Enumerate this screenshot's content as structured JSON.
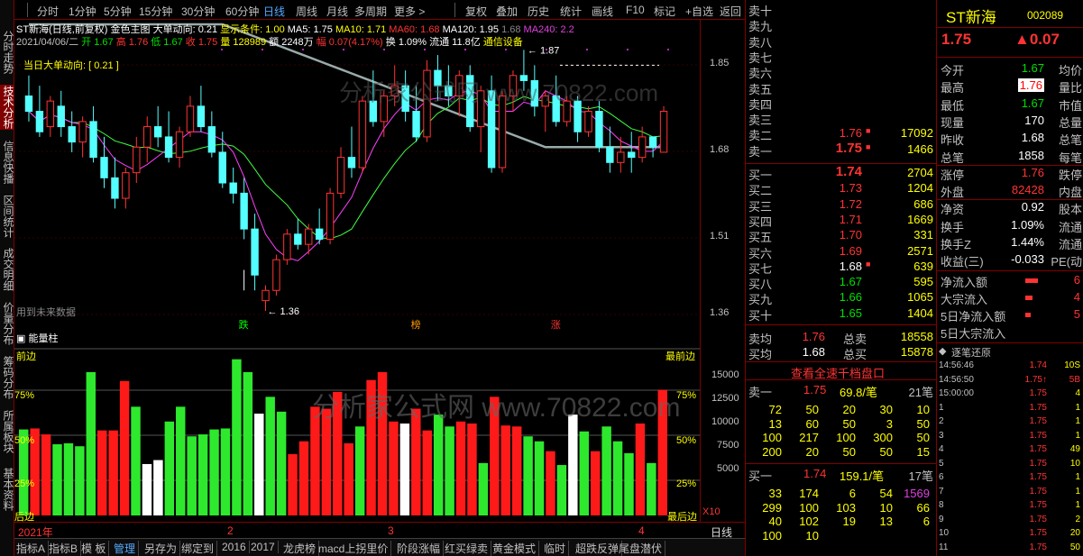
{
  "left_nav": [
    "分时走势",
    "技术分析",
    "信息快播",
    "区间统计",
    "成交明细",
    "价量分布",
    "筹码分布",
    "所属板块",
    "基本资料"
  ],
  "toolbar": {
    "items": [
      "分时",
      "1分钟",
      "5分钟",
      "15分钟",
      "30分钟",
      "60分钟",
      "日线",
      "周线",
      "月线",
      "多周期",
      "更多 >",
      "复权",
      "叠加",
      "历史",
      "统计",
      "画线",
      "F10",
      "标记",
      "+自选",
      "返回"
    ],
    "active": "日线"
  },
  "chart_info": {
    "title": "ST新海(日线,前复权)",
    "template": "金色主图",
    "dadong": "大单动向: 0.21",
    "show_cond": "显示条件: 1.00",
    "ma5": "MA5: 1.75",
    "ma10": "MA10: 1.71",
    "ma60": "MA60: 1.68",
    "ma120": "MA120: 1.95",
    "ma_extra": "1.68",
    "ma240": "MA240: 2.2",
    "date_line": "2021/04/06/二",
    "open": "开 1.67",
    "high": "高 1.76",
    "low": "低 1.67",
    "close": "收 1.75",
    "vol": "量 128989",
    "amt": "额 2248万",
    "amp": "幅 0.07(4.17%)",
    "turn": "换 1.09%",
    "float": "流通 11.8亿",
    "sector": "通信设备"
  },
  "chart_labels": {
    "dadong_tag": "当日大单动向: [ 0.21 ]",
    "future": "用到未来数据",
    "hi_mark": "1.87",
    "lo_mark": "1.36",
    "marker_die": "跌",
    "marker_bang": "榜",
    "marker_zhang": "涨",
    "watermark": "分析家公式网 www.70822.com"
  },
  "y_axis": [
    "1.85",
    "1.68",
    "1.51",
    "1.36"
  ],
  "vol_panel": {
    "title": "能量柱",
    "left_top": "前边",
    "right_top": "最前边",
    "right_bottom": "最后边",
    "left_bottom": "后边",
    "p75": "75%",
    "p50": "50%",
    "p25": "25%",
    "x10": "X10",
    "y": [
      "15000",
      "12500",
      "10000",
      "7500",
      "5000"
    ]
  },
  "date_axis": {
    "year": "2021年",
    "m2": "2",
    "m3": "3",
    "m4": "4",
    "period": "日线"
  },
  "bottom_tabs": [
    "指标A",
    "指标B",
    "模 板",
    "管理",
    "另存为",
    "绑定到",
    "2016",
    "2017",
    "龙虎榜",
    "macd上拐里价",
    "阶段涨幅",
    "红买绿卖",
    "黄金模式",
    "临时",
    "超跌反弹",
    "尾盘潜伏"
  ],
  "bottom_active": "管理",
  "chart_data": {
    "type": "candlestick",
    "title": "ST新海(日线,前复权)",
    "ylim": [
      1.33,
      1.92
    ],
    "ohlc": [
      [
        1.78,
        1.82,
        1.73,
        1.75
      ],
      [
        1.75,
        1.8,
        1.7,
        1.71
      ],
      [
        1.72,
        1.78,
        1.7,
        1.77
      ],
      [
        1.76,
        1.79,
        1.7,
        1.72
      ],
      [
        1.72,
        1.75,
        1.67,
        1.69
      ],
      [
        1.69,
        1.74,
        1.66,
        1.73
      ],
      [
        1.73,
        1.76,
        1.65,
        1.66
      ],
      [
        1.66,
        1.7,
        1.6,
        1.62
      ],
      [
        1.62,
        1.66,
        1.56,
        1.58
      ],
      [
        1.58,
        1.64,
        1.56,
        1.63
      ],
      [
        1.63,
        1.7,
        1.61,
        1.68
      ],
      [
        1.68,
        1.74,
        1.65,
        1.72
      ],
      [
        1.72,
        1.76,
        1.68,
        1.7
      ],
      [
        1.7,
        1.75,
        1.65,
        1.66
      ],
      [
        1.66,
        1.72,
        1.64,
        1.71
      ],
      [
        1.71,
        1.78,
        1.7,
        1.76
      ],
      [
        1.76,
        1.8,
        1.71,
        1.72
      ],
      [
        1.72,
        1.75,
        1.66,
        1.67
      ],
      [
        1.67,
        1.71,
        1.6,
        1.61
      ],
      [
        1.61,
        1.64,
        1.57,
        1.59
      ],
      [
        1.59,
        1.62,
        1.5,
        1.52
      ],
      [
        1.52,
        1.55,
        1.4,
        1.43
      ],
      [
        1.38,
        1.41,
        1.36,
        1.4
      ],
      [
        1.4,
        1.47,
        1.39,
        1.46
      ],
      [
        1.46,
        1.52,
        1.45,
        1.51
      ],
      [
        1.51,
        1.54,
        1.48,
        1.49
      ],
      [
        1.49,
        1.53,
        1.47,
        1.52
      ],
      [
        1.52,
        1.56,
        1.49,
        1.5
      ],
      [
        1.5,
        1.6,
        1.49,
        1.59
      ],
      [
        1.59,
        1.68,
        1.58,
        1.66
      ],
      [
        1.66,
        1.72,
        1.62,
        1.64
      ],
      [
        1.64,
        1.78,
        1.63,
        1.77
      ],
      [
        1.77,
        1.83,
        1.72,
        1.73
      ],
      [
        1.73,
        1.79,
        1.7,
        1.78
      ],
      [
        1.78,
        1.84,
        1.76,
        1.8
      ],
      [
        1.8,
        1.83,
        1.73,
        1.75
      ],
      [
        1.75,
        1.8,
        1.69,
        1.7
      ],
      [
        1.7,
        1.85,
        1.69,
        1.83
      ],
      [
        1.83,
        1.86,
        1.77,
        1.8
      ],
      [
        1.8,
        1.84,
        1.76,
        1.78
      ],
      [
        1.78,
        1.83,
        1.74,
        1.82
      ],
      [
        1.82,
        1.84,
        1.71,
        1.72
      ],
      [
        1.72,
        1.8,
        1.67,
        1.79
      ],
      [
        1.79,
        1.82,
        1.63,
        1.64
      ],
      [
        1.64,
        1.79,
        1.63,
        1.78
      ],
      [
        1.78,
        1.83,
        1.75,
        1.82
      ],
      [
        1.82,
        1.87,
        1.79,
        1.81
      ],
      [
        1.81,
        1.84,
        1.74,
        1.76
      ],
      [
        1.76,
        1.79,
        1.71,
        1.78
      ],
      [
        1.78,
        1.82,
        1.72,
        1.73
      ],
      [
        1.73,
        1.78,
        1.72,
        1.77
      ],
      [
        1.77,
        1.78,
        1.69,
        1.71
      ],
      [
        1.71,
        1.76,
        1.7,
        1.75
      ],
      [
        1.75,
        1.77,
        1.67,
        1.68
      ],
      [
        1.68,
        1.72,
        1.63,
        1.65
      ],
      [
        1.65,
        1.7,
        1.63,
        1.67
      ],
      [
        1.67,
        1.71,
        1.63,
        1.66
      ],
      [
        1.66,
        1.72,
        1.65,
        1.7
      ],
      [
        1.7,
        1.7,
        1.66,
        1.68
      ],
      [
        1.67,
        1.76,
        1.67,
        1.75
      ]
    ],
    "ma_series": [
      {
        "name": "MA5",
        "color": "#ff40ff"
      },
      {
        "name": "MA10",
        "color": "#40ff40"
      },
      {
        "name": "MA120",
        "color": "#9aa"
      }
    ],
    "volume": [
      {
        "v": 8700,
        "c": "g"
      },
      {
        "v": 8800,
        "c": "r"
      },
      {
        "v": 8200,
        "c": "r"
      },
      {
        "v": 7200,
        "c": "g"
      },
      {
        "v": 7300,
        "c": "g"
      },
      {
        "v": 7000,
        "c": "g"
      },
      {
        "v": 14500,
        "c": "g"
      },
      {
        "v": 8600,
        "c": "r"
      },
      {
        "v": 8600,
        "c": "r"
      },
      {
        "v": 13600,
        "c": "r"
      },
      {
        "v": 11000,
        "c": "g"
      },
      {
        "v": 5200,
        "c": "w"
      },
      {
        "v": 5600,
        "c": "w"
      },
      {
        "v": 9500,
        "c": "g"
      },
      {
        "v": 11000,
        "c": "g"
      },
      {
        "v": 8000,
        "c": "g"
      },
      {
        "v": 8200,
        "c": "g"
      },
      {
        "v": 8700,
        "c": "g"
      },
      {
        "v": 8800,
        "c": "g"
      },
      {
        "v": 15800,
        "c": "g"
      },
      {
        "v": 14500,
        "c": "g"
      },
      {
        "v": 10300,
        "c": "w"
      },
      {
        "v": 12000,
        "c": "g"
      },
      {
        "v": 10500,
        "c": "g"
      },
      {
        "v": 6200,
        "c": "r"
      },
      {
        "v": 7500,
        "c": "r"
      },
      {
        "v": 11000,
        "c": "r"
      },
      {
        "v": 10800,
        "c": "r"
      },
      {
        "v": 12500,
        "c": "r"
      },
      {
        "v": 7300,
        "c": "r"
      },
      {
        "v": 9000,
        "c": "g"
      },
      {
        "v": 13700,
        "c": "r"
      },
      {
        "v": 14500,
        "c": "r"
      },
      {
        "v": 9500,
        "c": "r"
      },
      {
        "v": 9300,
        "c": "w"
      },
      {
        "v": 10800,
        "c": "r"
      },
      {
        "v": 8600,
        "c": "r"
      },
      {
        "v": 10200,
        "c": "g"
      },
      {
        "v": 9000,
        "c": "g"
      },
      {
        "v": 9500,
        "c": "r"
      },
      {
        "v": 9300,
        "c": "r"
      },
      {
        "v": 5300,
        "c": "g"
      },
      {
        "v": 12000,
        "c": "r"
      },
      {
        "v": 9100,
        "c": "r"
      },
      {
        "v": 9000,
        "c": "r"
      },
      {
        "v": 8000,
        "c": "g"
      },
      {
        "v": 7500,
        "c": "g"
      },
      {
        "v": 6500,
        "c": "r"
      },
      {
        "v": 5100,
        "c": "g"
      },
      {
        "v": 10200,
        "c": "w"
      },
      {
        "v": 8500,
        "c": "g"
      },
      {
        "v": 6500,
        "c": "r"
      },
      {
        "v": 9000,
        "c": "g"
      },
      {
        "v": 7500,
        "c": "g"
      },
      {
        "v": 6300,
        "c": "g"
      },
      {
        "v": 9300,
        "c": "r"
      },
      {
        "v": 5300,
        "c": "g"
      },
      {
        "v": 12700,
        "c": "r"
      }
    ]
  },
  "orderbook": {
    "sells": [
      {
        "l": "卖十",
        "p": "",
        "v": ""
      },
      {
        "l": "卖九",
        "p": "",
        "v": ""
      },
      {
        "l": "卖八",
        "p": "",
        "v": ""
      },
      {
        "l": "卖七",
        "p": "",
        "v": ""
      },
      {
        "l": "卖六",
        "p": "",
        "v": ""
      },
      {
        "l": "卖五",
        "p": "",
        "v": ""
      },
      {
        "l": "卖四",
        "p": "",
        "v": ""
      },
      {
        "l": "卖三",
        "p": "",
        "v": ""
      },
      {
        "l": "卖二",
        "p": "1.76",
        "v": "17092"
      },
      {
        "l": "卖一",
        "p": "1.75",
        "v": "1466"
      }
    ],
    "buys": [
      {
        "l": "买一",
        "p": "1.74",
        "v": "2704"
      },
      {
        "l": "买二",
        "p": "1.73",
        "v": "1204"
      },
      {
        "l": "买三",
        "p": "1.72",
        "v": "686"
      },
      {
        "l": "买四",
        "p": "1.71",
        "v": "1669"
      },
      {
        "l": "买五",
        "p": "1.70",
        "v": "331"
      },
      {
        "l": "买六",
        "p": "1.69",
        "v": "2571"
      },
      {
        "l": "买七",
        "p": "1.68",
        "v": "639"
      },
      {
        "l": "买八",
        "p": "1.67",
        "v": "595"
      },
      {
        "l": "买九",
        "p": "1.66",
        "v": "1065"
      },
      {
        "l": "买十",
        "p": "1.65",
        "v": "1404"
      }
    ],
    "sell_avg": {
      "l": "卖均",
      "p": "1.76",
      "l2": "总卖",
      "v": "18558"
    },
    "buy_avg": {
      "l": "买均",
      "p": "1.68",
      "l2": "总买",
      "v": "15878"
    },
    "view_all": "查看全速千档盘口",
    "s1": {
      "l": "卖一",
      "p": "1.75",
      "a": "69.8/笔",
      "n": "21笔"
    },
    "s1_rows": [
      [
        "72",
        "50",
        "20",
        "30",
        "10"
      ],
      [
        "13",
        "60",
        "50",
        "3",
        "50"
      ],
      [
        "100",
        "217",
        "100",
        "300",
        "50"
      ],
      [
        "200",
        "20",
        "50",
        "50",
        "15"
      ]
    ],
    "b1": {
      "l": "买一",
      "p": "1.74",
      "a": "159.1/笔",
      "n": "17笔"
    },
    "b1_rows": [
      [
        "33",
        "174",
        "6",
        "54",
        "1569"
      ],
      [
        "299",
        "100",
        "103",
        "10",
        "66"
      ],
      [
        "40",
        "102",
        "19",
        "13",
        "6"
      ],
      [
        "100",
        "10",
        "",
        "",
        ""
      ]
    ]
  },
  "quote": {
    "name": "ST新海",
    "code": "002089",
    "price": "1.75",
    "change": "▲0.07",
    "rows": [
      {
        "a": "今开",
        "av": "1.67",
        "ac": "green",
        "b": "均价"
      },
      {
        "a": "最高",
        "av": "1.76",
        "ac": "red",
        "b": "量比"
      },
      {
        "a": "最低",
        "av": "1.67",
        "ac": "green",
        "b": "市值"
      },
      {
        "a": "现量",
        "av": "170",
        "ac": "white",
        "b": "总量"
      },
      {
        "a": "昨收",
        "av": "1.68",
        "ac": "white",
        "b": "总笔"
      },
      {
        "a": "总笔",
        "av": "1858",
        "ac": "white",
        "b": "每笔"
      },
      {
        "a": "涨停",
        "av": "1.76",
        "ac": "red",
        "b": "跌停"
      },
      {
        "a": "外盘",
        "av": "82428",
        "ac": "red",
        "b": "内盘"
      },
      {
        "a": "净资",
        "av": "0.92",
        "ac": "white",
        "b": "股本"
      },
      {
        "a": "换手",
        "av": "1.09%",
        "ac": "white",
        "b": "流通"
      },
      {
        "a": "换手Z",
        "av": "1.44%",
        "ac": "white",
        "b": "流通"
      },
      {
        "a": "收益(三)",
        "av": "-0.033",
        "ac": "white",
        "b": "PE(动"
      }
    ],
    "flows": [
      {
        "l": "净流入额",
        "v": "6"
      },
      {
        "l": "大宗流入",
        "v": "4"
      },
      {
        "l": "5日净流入额",
        "v": "5"
      },
      {
        "l": "5日大宗流入",
        "v": ""
      }
    ],
    "ticks_title": "逐笔还原",
    "ticks": [
      [
        "14:56:46",
        "1.74",
        "10S",
        "yellow"
      ],
      [
        "14:56:50",
        "1.75↑",
        "5B",
        "red"
      ],
      [
        "15:00:00",
        "1.75",
        "4",
        "yellow"
      ],
      [
        "1",
        "1.75",
        "1",
        "yellow"
      ],
      [
        "2",
        "1.75",
        "1",
        "yellow"
      ],
      [
        "3",
        "1.75",
        "1",
        "yellow"
      ],
      [
        "4",
        "1.75",
        "49",
        "yellow"
      ],
      [
        "5",
        "1.75",
        "10",
        "yellow"
      ],
      [
        "6",
        "1.75",
        "1",
        "yellow"
      ],
      [
        "7",
        "1.75",
        "1",
        "yellow"
      ],
      [
        "8",
        "1.75",
        "1",
        "yellow"
      ],
      [
        "9",
        "1.75",
        "2",
        "yellow"
      ],
      [
        "10",
        "1.75",
        "20",
        "yellow"
      ],
      [
        "11",
        "1.75",
        "50",
        "yellow"
      ]
    ]
  }
}
